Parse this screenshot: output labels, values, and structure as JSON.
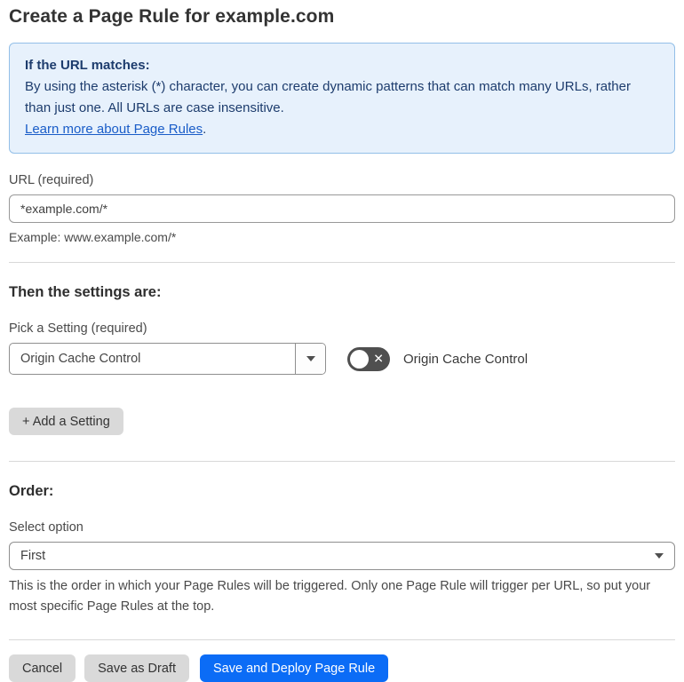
{
  "page": {
    "title": "Create a Page Rule for example.com"
  },
  "info_box": {
    "heading": "If the URL matches:",
    "body": "By using the asterisk (*) character, you can create dynamic patterns that can match many URLs, rather than just one. All URLs are case insensitive.",
    "link_text": "Learn more about Page Rules",
    "link_suffix": "."
  },
  "url_field": {
    "label": "URL (required)",
    "value": "*example.com/*",
    "example": "Example: www.example.com/*"
  },
  "settings_section": {
    "heading": "Then the settings are:",
    "pick_label": "Pick a Setting (required)",
    "selected_setting": "Origin Cache Control",
    "toggle": {
      "state": "off",
      "icon": "✕",
      "label": "Origin Cache Control"
    },
    "add_button_label": "+ Add a Setting"
  },
  "order_section": {
    "heading": "Order:",
    "select_label": "Select option",
    "selected_option": "First",
    "help_text": "This is the order in which your Page Rules will be triggered. Only one Page Rule will trigger per URL, so put your most specific Page Rules at the top."
  },
  "footer": {
    "cancel_label": "Cancel",
    "save_draft_label": "Save as Draft",
    "save_deploy_label": "Save and Deploy Page Rule"
  },
  "colors": {
    "primary_blue": "#0b6cf6",
    "info_background": "#e7f1fc",
    "info_border": "#93bfe8",
    "info_text": "#1d3c6d",
    "link_blue": "#1a5dc8",
    "toggle_track": "#4f4f4f",
    "gray_button": "#d9d9d9"
  }
}
